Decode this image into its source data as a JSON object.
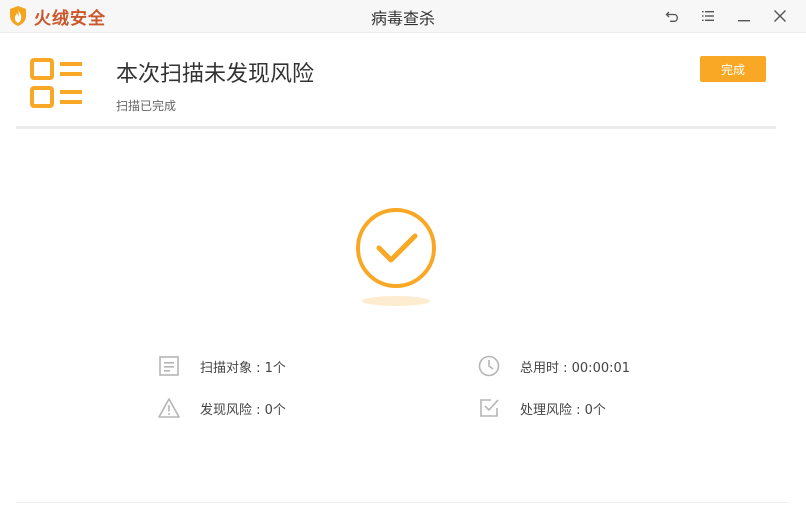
{
  "app": {
    "brand": "火绒安全",
    "window_title": "病毒查杀"
  },
  "result": {
    "title": "本次扫描未发现风险",
    "subtitle": "扫描已完成",
    "done_label": "完成"
  },
  "stats": {
    "scan_objects": "扫描对象 : 1个",
    "time_used": "总用时 : 00:00:01",
    "risks_found": "发现风险 : 0个",
    "risks_handled": "处理风险 : 0个"
  },
  "colors": {
    "accent": "#f9a825",
    "brand": "#c9572a",
    "icon_gray": "#b5b5b5"
  }
}
